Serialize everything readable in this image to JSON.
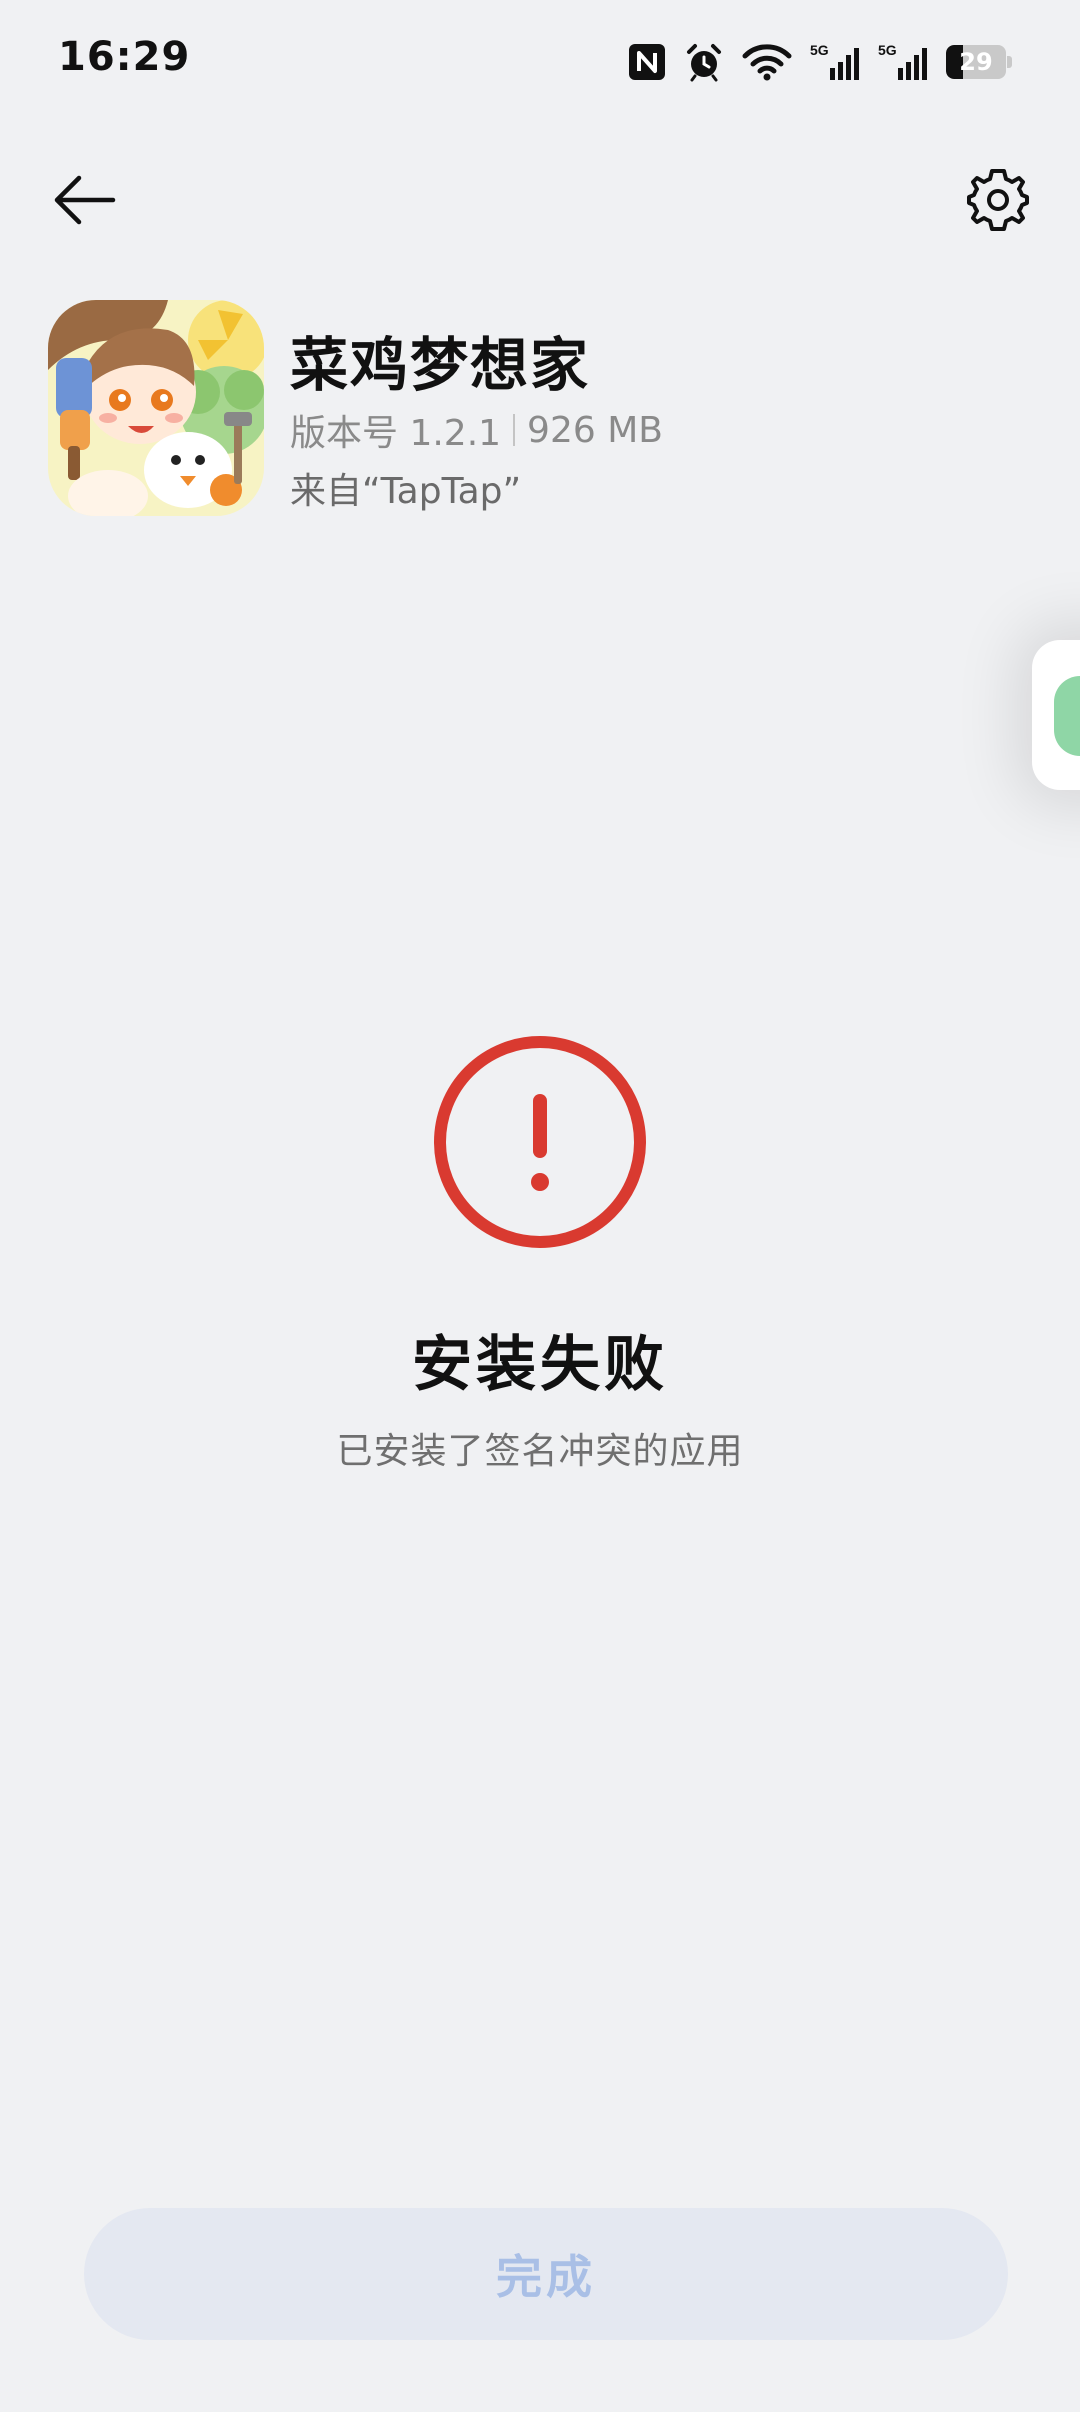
{
  "status_bar": {
    "time": "16:29",
    "battery_level": "29",
    "battery_fraction": 0.29,
    "signal_1_label": "5G",
    "signal_2_label": "5G",
    "icons": [
      "nfc-icon",
      "alarm-icon",
      "wifi-icon",
      "signal-5g-icon",
      "signal-5g-icon",
      "battery-icon"
    ]
  },
  "nav": {
    "back_icon": "arrow-left-icon",
    "settings_icon": "gear-icon"
  },
  "app": {
    "name": "菜鸡梦想家",
    "version": "版本号 1.2.1",
    "size": "926 MB",
    "source": "来自“TapTap”"
  },
  "result": {
    "status_icon": "error-exclamation-icon",
    "title": "安装失败",
    "message": "已安装了签名冲突的应用"
  },
  "footer": {
    "done_label": "完成"
  },
  "colors": {
    "background": "#f0f1f3",
    "error_red": "#d93a30",
    "button_bg": "#e4e8f1",
    "button_text_disabled": "#a9bfe6",
    "floating_bubble_green": "#8fd6a6"
  }
}
